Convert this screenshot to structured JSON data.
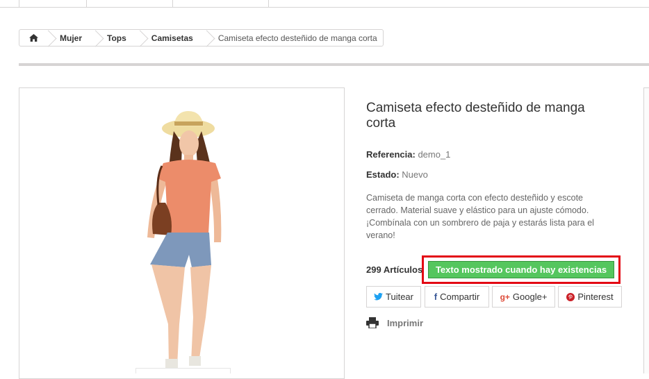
{
  "breadcrumb": {
    "home_icon": "home-icon",
    "items": [
      "Mujer",
      "Tops",
      "Camisetas"
    ],
    "current": "Camiseta efecto desteñido de manga corta"
  },
  "product": {
    "title": "Camiseta efecto desteñido de manga corta",
    "reference_label": "Referencia:",
    "reference_value": "demo_1",
    "condition_label": "Estado:",
    "condition_value": "Nuevo",
    "description": "Camiseta de manga corta con efecto desteñido y escote cerrado. Material suave y elástico para un ajuste cómodo. ¡Combínala con un sombrero de paja y estarás lista para el verano!",
    "quantity": "299",
    "quantity_label": "Artículos",
    "stock_message": "Texto mostrado cuando hay existencias"
  },
  "social": {
    "tweet": "Tuitear",
    "share": "Compartir",
    "google": "Google+",
    "pinterest": "Pinterest"
  },
  "print_label": "Imprimir",
  "colors": {
    "stock_green": "#55c65e",
    "highlight_red": "#e30613",
    "twitter_blue": "#1da1f2",
    "facebook_blue": "#3b5998",
    "google_red": "#dd4b39",
    "pinterest_red": "#cb2027"
  }
}
